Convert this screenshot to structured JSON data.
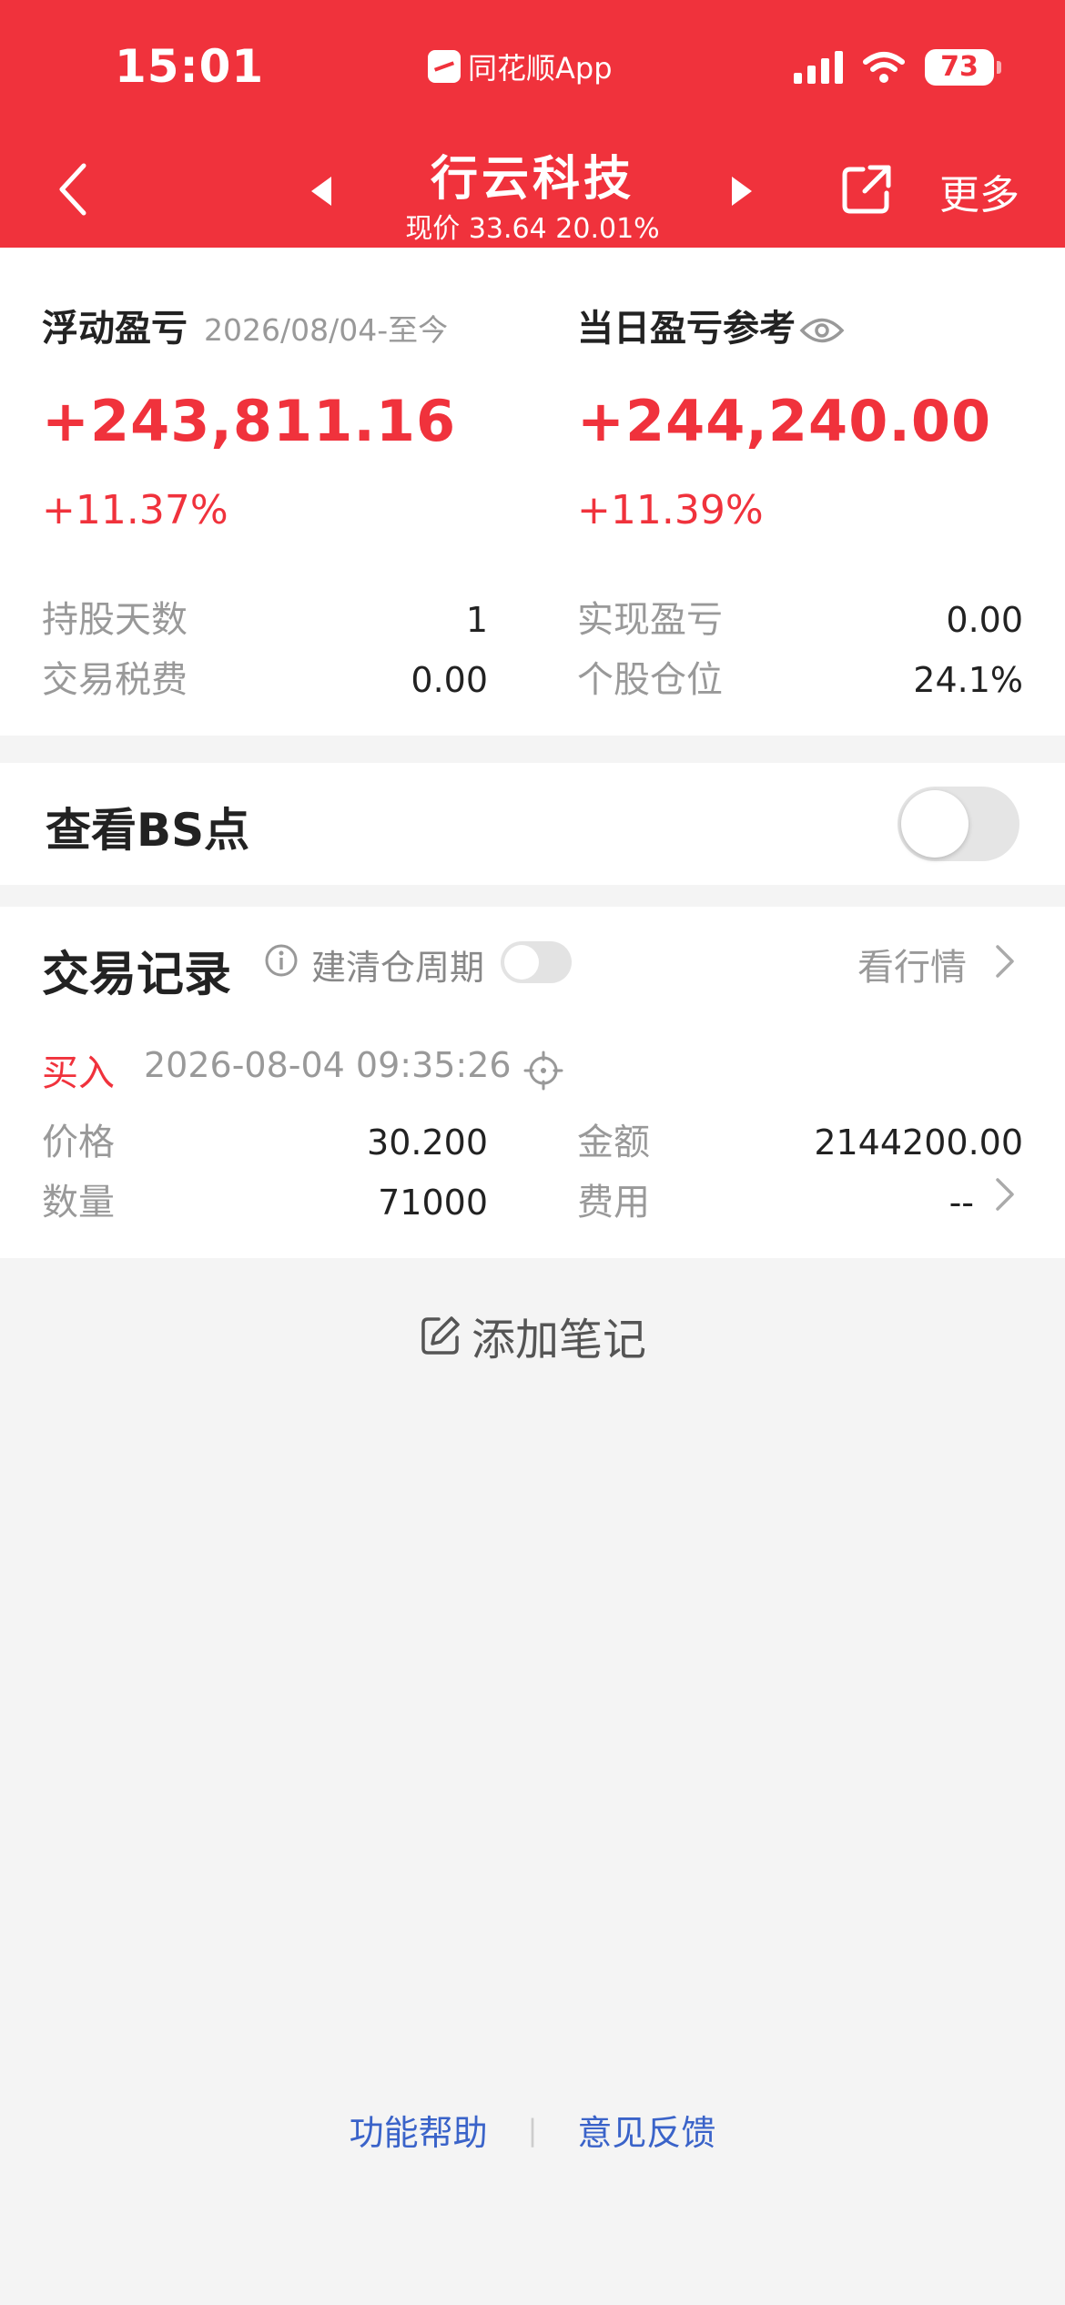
{
  "status_bar": {
    "time": "15:01",
    "app_name": "同花顺App",
    "battery": "73"
  },
  "header": {
    "title": "行云科技",
    "subtitle": "现价 33.64 20.01%",
    "more_label": "更多"
  },
  "summary": {
    "floating": {
      "title": "浮动盈亏",
      "date_range": "2026/08/04-至今",
      "amount": "+243,811.16",
      "percent": "+11.37%"
    },
    "daily": {
      "title": "当日盈亏参考",
      "amount": "+244,240.00",
      "percent": "+11.39%"
    },
    "stats": [
      {
        "label": "持股天数",
        "value": "1"
      },
      {
        "label": "实现盈亏",
        "value": "0.00"
      },
      {
        "label": "交易税费",
        "value": "0.00"
      },
      {
        "label": "个股仓位",
        "value": "24.1%"
      }
    ]
  },
  "bs_points": {
    "label": "查看BS点",
    "enabled": false
  },
  "records": {
    "title": "交易记录",
    "clear_cycle_label": "建清仓周期",
    "clear_cycle_enabled": false,
    "market_link": "看行情",
    "trade": {
      "type": "买入",
      "time": "2026-08-04 09:35:26",
      "fields": [
        {
          "label": "价格",
          "value": "30.200"
        },
        {
          "label": "金额",
          "value": "2144200.00"
        },
        {
          "label": "数量",
          "value": "71000"
        },
        {
          "label": "费用",
          "value": "--"
        }
      ]
    }
  },
  "add_note_label": "添加笔记",
  "footer": {
    "help": "功能帮助",
    "feedback": "意见反馈"
  },
  "colors": {
    "brand_red": "#f0323c",
    "link_blue": "#3a63c9"
  }
}
